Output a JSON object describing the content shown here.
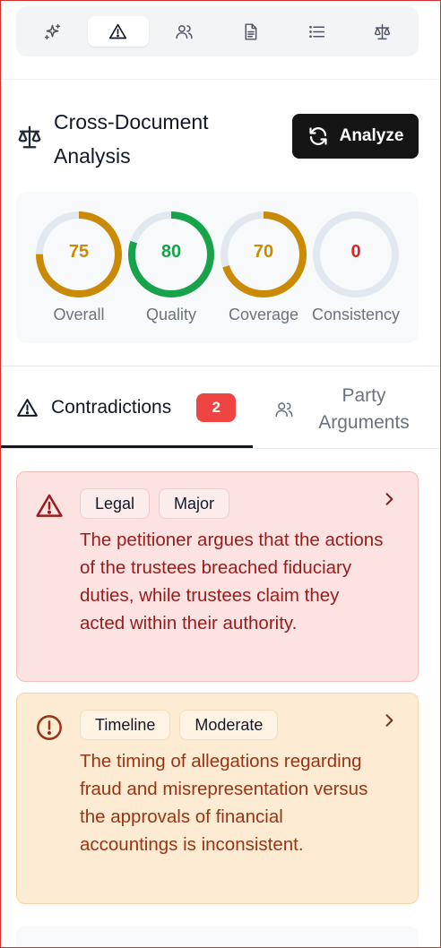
{
  "toolbar": {
    "items": [
      {
        "icon": "sparkles-icon",
        "active": false
      },
      {
        "icon": "alert-triangle-icon",
        "active": true
      },
      {
        "icon": "users-icon",
        "active": false
      },
      {
        "icon": "document-icon",
        "active": false
      },
      {
        "icon": "list-icon",
        "active": false
      },
      {
        "icon": "scale-icon",
        "active": false
      }
    ]
  },
  "header": {
    "title": "Cross-Document Analysis",
    "analyze_label": "Analyze"
  },
  "scores": [
    {
      "label": "Overall",
      "value": 75,
      "color": "#ca8a04"
    },
    {
      "label": "Quality",
      "value": 80,
      "color": "#16a34a"
    },
    {
      "label": "Coverage",
      "value": 70,
      "color": "#ca8a04"
    },
    {
      "label": "Consistency",
      "value": 0,
      "color": "#dc2626"
    }
  ],
  "tabs": {
    "contradictions": {
      "label": "Contradictions",
      "badge": "2"
    },
    "party": {
      "label": "Party Arguments"
    }
  },
  "contradictions": [
    {
      "category": "Legal",
      "severity": "Major",
      "text": "The petitioner argues that the actions of the trustees breached fiduciary duties, while trustees claim they acted within their authority."
    },
    {
      "category": "Timeline",
      "severity": "Moderate",
      "text": "The timing of allegations regarding fraud and misrepresentation versus the approvals of financial accountings is inconsistent."
    }
  ],
  "colors": {
    "major_bg": "#fde2e2",
    "moderate_bg": "#feebd3",
    "gauge_track": "#e2e8f0",
    "button_dark": "#151515"
  }
}
